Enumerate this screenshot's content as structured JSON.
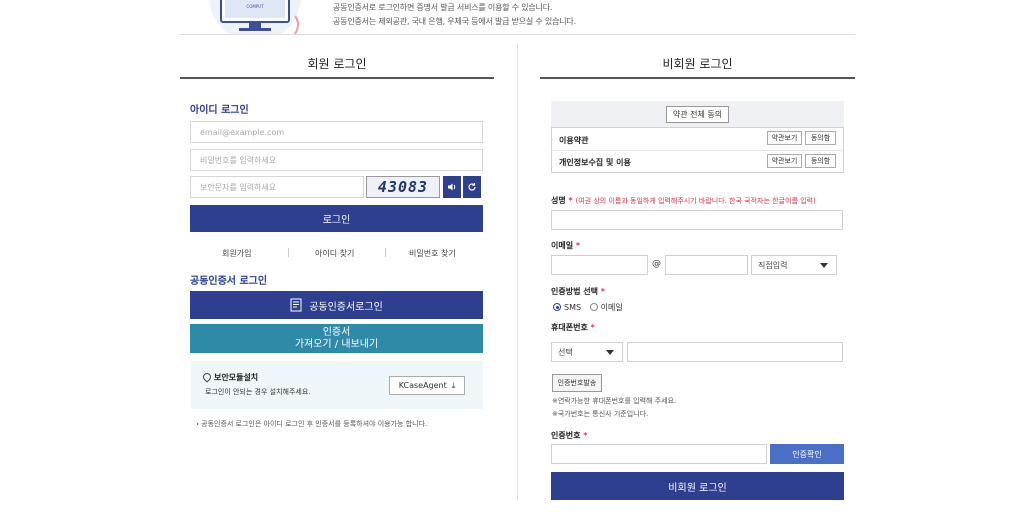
{
  "banner": {
    "notice_1": "공동인증서로 로그인하면 증명서 발급 서비스를 이용할 수 있습니다.",
    "notice_2": "공동인증서는 제외공관, 국내 은행, 우체국 등에서 발급 받으실 수 있습니다.",
    "monitor_label": "COMPUT"
  },
  "member": {
    "title": "회원 로그인",
    "id_login_heading": "아이디 로그인",
    "email_placeholder": "email@example.com",
    "password_placeholder": "비밀번호를 입력하세요",
    "captcha_placeholder": "보안문자를 입력하세요",
    "captcha_text": "43083",
    "login_button": "로그인",
    "links": [
      "회원가입",
      "아이디 찾기",
      "비밀번호 찾기"
    ],
    "cert_heading": "공동인증서 로그인",
    "cert_login_button": "공동인증서로그인",
    "cert_transfer_line1": "인증서",
    "cert_transfer_line2": "가져오기 / 내보내기",
    "install_title": "보안모듈설치",
    "install_desc": "로그인이 안되는 경우 설치해주세요.",
    "kcase_button": "KCaseAgent",
    "footnote": "공동인증서 로그인은 아이디 로그인 후 인증서를 등록하셔야 이용가능 합니다."
  },
  "guest": {
    "title": "비회원 로그인",
    "agree_all": "약관 전체 동의",
    "terms": [
      {
        "label": "이용약관",
        "view": "약관보기",
        "agree": "동의함"
      },
      {
        "label": "개인정보수집 및 이용",
        "view": "약관보기",
        "agree": "동의함"
      }
    ],
    "name_label": "성명",
    "name_note": "(여권 상의 이름과 동일하게 입력해주시기 바랍니다. 한국 국적자는 한글이름 입력)",
    "email_label": "이메일",
    "at_sign": "@",
    "domain_select": "직접입력",
    "auth_method_label": "인증방법 선택",
    "auth_options": [
      "SMS",
      "이메일"
    ],
    "phone_label": "휴대폰번호",
    "phone_select": "선택",
    "send_code_button": "인증번호발송",
    "phone_note_1": "※연락가능한 휴대폰번호를 입력해 주세요.",
    "phone_note_2": "※국가번호는 통신사 기준입니다.",
    "code_label": "인증번호",
    "verify_button": "인증확인",
    "guest_login_button": "비회원 로그인"
  },
  "colors": {
    "navy": "#2e3f8f",
    "teal": "#2f8aa8",
    "required": "#e0314b",
    "verify": "#4a6fc4"
  }
}
